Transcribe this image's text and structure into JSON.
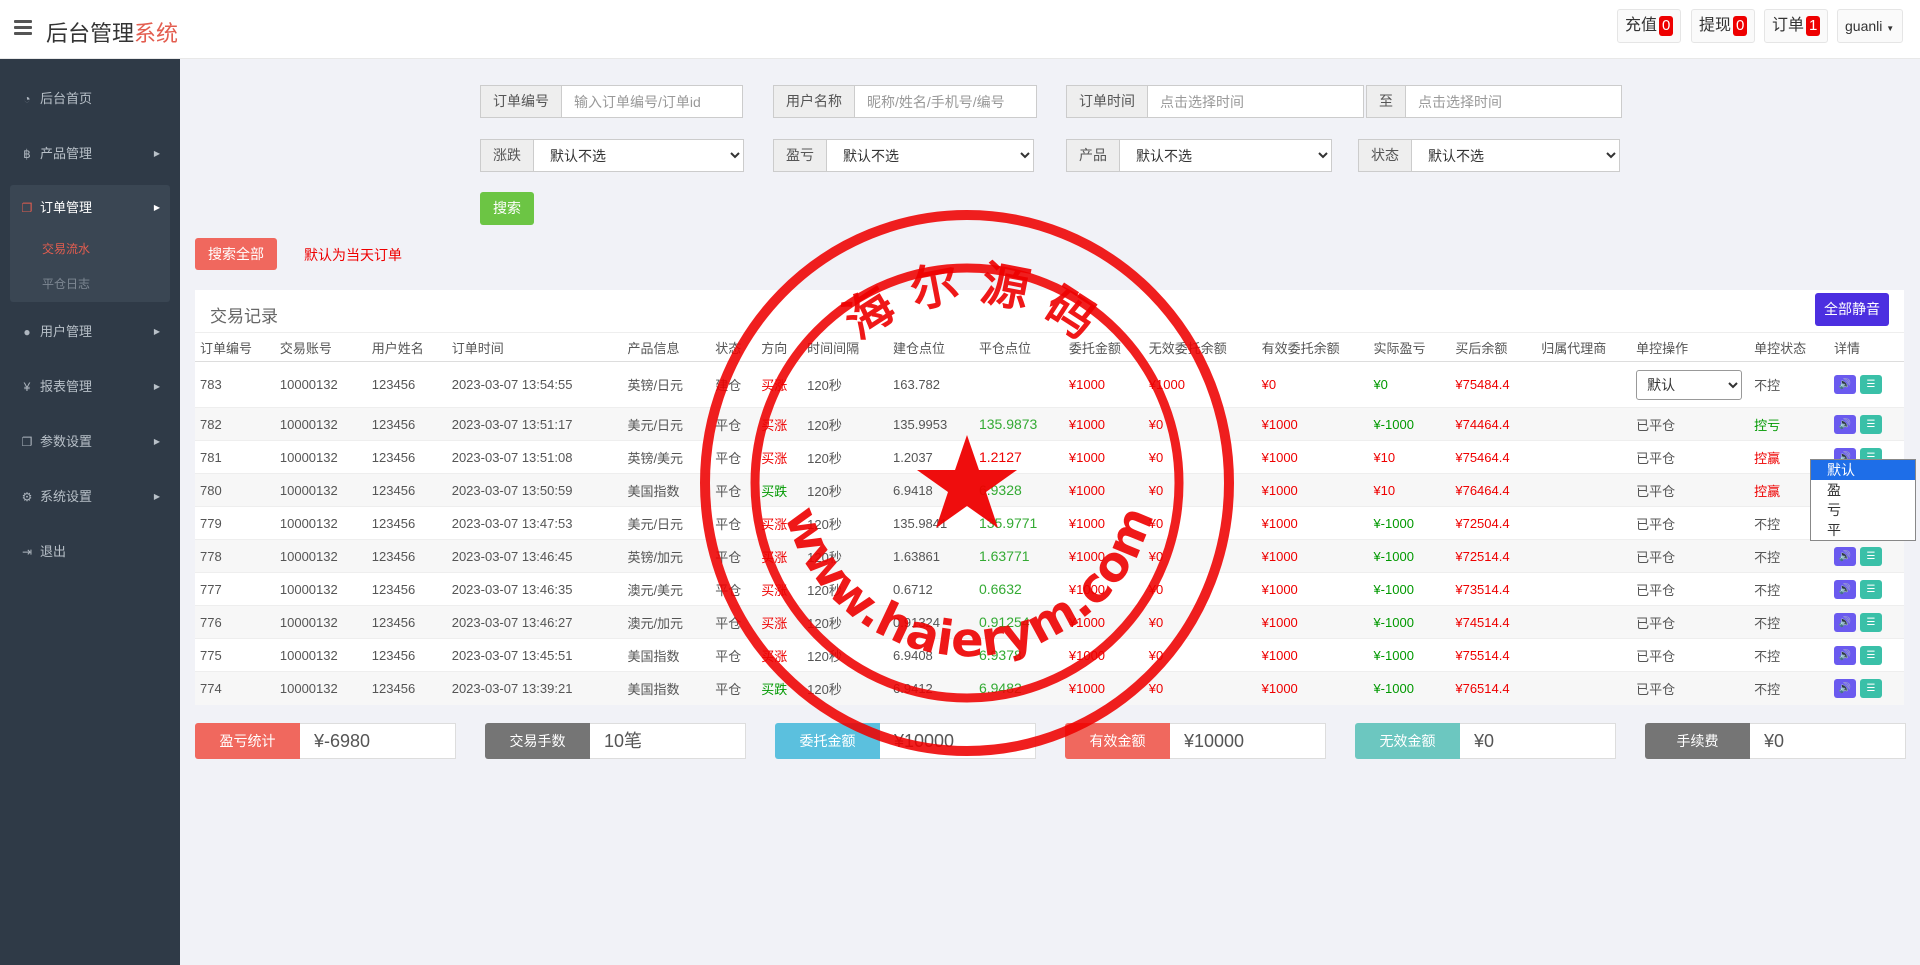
{
  "header": {
    "brand_main": "后台管理",
    "brand_accent": "系统",
    "recharge_label": "充值",
    "recharge_count": "0",
    "withdraw_label": "提现",
    "withdraw_count": "0",
    "orders_label": "订单",
    "orders_count": "1",
    "user_name": "guanli"
  },
  "sidebar": {
    "home": "后台首页",
    "products": "产品管理",
    "orders": "订单管理",
    "trade_flow": "交易流水",
    "close_log": "平仓日志",
    "users": "用户管理",
    "reports": "报表管理",
    "params": "参数设置",
    "system": "系统设置",
    "logout": "退出"
  },
  "filters": {
    "order_no_label": "订单编号",
    "order_no_placeholder": "输入订单编号/订单id",
    "user_label": "用户名称",
    "user_placeholder": "昵称/姓名/手机号/编号",
    "time_label": "订单时间",
    "time_placeholder": "点击选择时间",
    "to_label": "至",
    "time_end_placeholder": "点击选择时间",
    "rise_label": "涨跌",
    "rise_value": "默认不选",
    "pl_label": "盈亏",
    "pl_value": "默认不选",
    "product_label": "产品",
    "product_value": "默认不选",
    "status_label": "状态",
    "status_value": "默认不选",
    "search_btn": "搜索",
    "search_all_btn": "搜索全部",
    "default_note": "默认为当天订单"
  },
  "panel": {
    "title": "交易记录",
    "mute_all": "全部静音",
    "columns": [
      "订单编号",
      "交易账号",
      "用户姓名",
      "订单时间",
      "产品信息",
      "状态",
      "方向",
      "时间间隔",
      "建仓点位",
      "平仓点位",
      "委托金额",
      "无效委托余额",
      "有效委托余额",
      "实际盈亏",
      "买后余额",
      "归属代理商",
      "单控操作",
      "单控状态",
      "详情"
    ],
    "rows": [
      [
        "783",
        "10000132",
        "123456",
        "2023-03-07 13:54:55",
        "英镑/日元",
        "建仓",
        "买涨",
        "120秒",
        "163.782",
        "",
        "¥1000",
        "¥1000",
        "¥0",
        "¥0",
        "¥75484.4",
        "",
        "默认",
        "不控"
      ],
      [
        "782",
        "10000132",
        "123456",
        "2023-03-07 13:51:17",
        "美元/日元",
        "平仓",
        "买涨",
        "120秒",
        "135.9953",
        "135.9873",
        "¥1000",
        "¥0",
        "¥1000",
        "¥-1000",
        "¥74464.4",
        "",
        "已平仓",
        "控亏"
      ],
      [
        "781",
        "10000132",
        "123456",
        "2023-03-07 13:51:08",
        "英镑/美元",
        "平仓",
        "买涨",
        "120秒",
        "1.2037",
        "1.2127",
        "¥1000",
        "¥0",
        "¥1000",
        "¥10",
        "¥75464.4",
        "",
        "已平仓",
        "控赢"
      ],
      [
        "780",
        "10000132",
        "123456",
        "2023-03-07 13:50:59",
        "美国指数",
        "平仓",
        "买跌",
        "120秒",
        "6.9418",
        "6.9328",
        "¥1000",
        "¥0",
        "¥1000",
        "¥10",
        "¥76464.4",
        "",
        "已平仓",
        "控赢"
      ],
      [
        "779",
        "10000132",
        "123456",
        "2023-03-07 13:47:53",
        "美元/日元",
        "平仓",
        "买涨",
        "120秒",
        "135.9841",
        "135.9771",
        "¥1000",
        "¥0",
        "¥1000",
        "¥-1000",
        "¥72504.4",
        "",
        "已平仓",
        "不控"
      ],
      [
        "778",
        "10000132",
        "123456",
        "2023-03-07 13:46:45",
        "英镑/加元",
        "平仓",
        "买涨",
        "120秒",
        "1.63861",
        "1.63771",
        "¥1000",
        "¥0",
        "¥1000",
        "¥-1000",
        "¥72514.4",
        "",
        "已平仓",
        "不控"
      ],
      [
        "777",
        "10000132",
        "123456",
        "2023-03-07 13:46:35",
        "澳元/美元",
        "平仓",
        "买涨",
        "120秒",
        "0.6712",
        "0.6632",
        "¥1000",
        "¥0",
        "¥1000",
        "¥-1000",
        "¥73514.4",
        "",
        "已平仓",
        "不控"
      ],
      [
        "776",
        "10000132",
        "123456",
        "2023-03-07 13:46:27",
        "澳元/加元",
        "平仓",
        "买涨",
        "120秒",
        "0.91324",
        "0.91254",
        "¥1000",
        "¥0",
        "¥1000",
        "¥-1000",
        "¥74514.4",
        "",
        "已平仓",
        "不控"
      ],
      [
        "775",
        "10000132",
        "123456",
        "2023-03-07 13:45:51",
        "美国指数",
        "平仓",
        "买涨",
        "120秒",
        "6.9408",
        "6.9378",
        "¥1000",
        "¥0",
        "¥1000",
        "¥-1000",
        "¥75514.4",
        "",
        "已平仓",
        "不控"
      ],
      [
        "774",
        "10000132",
        "123456",
        "2023-03-07 13:39:21",
        "美国指数",
        "平仓",
        "买跌",
        "120秒",
        "6.9412",
        "6.9482",
        "¥1000",
        "¥0",
        "¥1000",
        "¥-1000",
        "¥76514.4",
        "",
        "已平仓",
        "不控"
      ]
    ],
    "dropdown_options": [
      "默认",
      "盈",
      "亏",
      "平"
    ]
  },
  "stats": {
    "pl_label": "盈亏统计",
    "pl_value": "¥-6980",
    "count_label": "交易手数",
    "count_value": "10笔",
    "entrust_label": "委托金额",
    "entrust_value": "¥10000",
    "valid_label": "有效金额",
    "valid_value": "¥10000",
    "invalid_label": "无效金额",
    "invalid_value": "¥0",
    "fee_label": "手续费",
    "fee_value": "¥0"
  },
  "colors": {
    "sidebar_bg": "#2f3a47",
    "accent_red": "#e35d4f",
    "search_green": "#6cc544",
    "mute_purple": "#4c2fe0",
    "stat_pl": "#f0685e",
    "stat_count": "#757575",
    "stat_entrust": "#5bc0de",
    "stat_valid": "#f0685e",
    "stat_invalid": "#6cc7c0",
    "stat_fee": "#757575"
  },
  "watermark": {
    "top_text": "海 尔 源 码",
    "bottom_text": "www.haierym.com"
  }
}
